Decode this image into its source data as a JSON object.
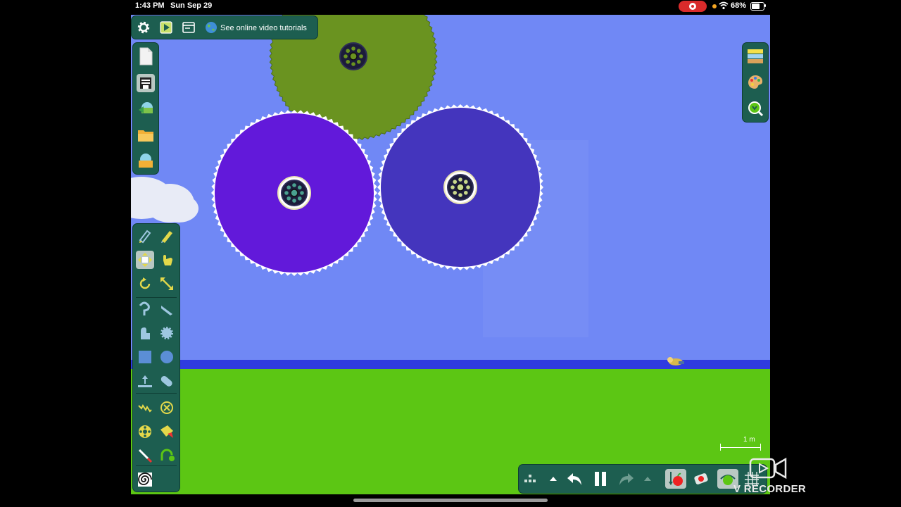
{
  "status_bar": {
    "time": "1:43 PM",
    "date": "Sun Sep 29",
    "battery": "68%",
    "battery_level": 0.68
  },
  "top_toolbar": {
    "tutorial_label": "See online video tutorials",
    "icons": [
      "gear-icon",
      "play-scene-icon",
      "window-icon",
      "globe-icon"
    ]
  },
  "file_toolbar": {
    "icons": [
      "new-document-icon",
      "save-icon",
      "open-scene-icon",
      "folder-icon",
      "browse-scenes-icon"
    ]
  },
  "right_toolbar": {
    "icons": [
      "background-icon",
      "palette-icon",
      "zoom-icon"
    ]
  },
  "tools": [
    {
      "name": "sketch-tool",
      "icon": "pencil-hand-icon"
    },
    {
      "name": "pencil-tool",
      "icon": "pencil-icon"
    },
    {
      "name": "move-tool",
      "icon": "move-arrows-icon",
      "selected": true
    },
    {
      "name": "drag-tool",
      "icon": "hand-icon"
    },
    {
      "name": "rotate-tool",
      "icon": "rotate-icon"
    },
    {
      "name": "scale-tool",
      "icon": "scale-arrows-icon"
    },
    {
      "name": "rope-tool",
      "icon": "rope-icon"
    },
    {
      "name": "knife-tool",
      "icon": "knife-icon"
    },
    {
      "name": "brush-tool",
      "icon": "brush-icon"
    },
    {
      "name": "gear-tool",
      "icon": "gear-shape-icon"
    },
    {
      "name": "box-tool",
      "icon": "square-icon"
    },
    {
      "name": "circle-tool",
      "icon": "circle-icon"
    },
    {
      "name": "plane-tool",
      "icon": "plane-icon"
    },
    {
      "name": "polygon-tool",
      "icon": "capsule-icon"
    },
    {
      "name": "spring-tool",
      "icon": "spring-icon"
    },
    {
      "name": "fixate-tool",
      "icon": "fixate-icon"
    },
    {
      "name": "axle-tool",
      "icon": "axle-icon"
    },
    {
      "name": "thruster-tool",
      "icon": "thruster-icon"
    },
    {
      "name": "laser-tool",
      "icon": "laser-icon"
    },
    {
      "name": "hinge-tool",
      "icon": "hinge-icon"
    },
    {
      "name": "tracer-tool",
      "icon": "spiral-icon"
    }
  ],
  "bottom_toolbar": {
    "icons": [
      "grid-icon",
      "chevron-up-icon",
      "undo-icon",
      "pause-icon",
      "redo-icon",
      "chevron-up-icon",
      "gravity-icon",
      "air-friction-icon",
      "camera-follow-icon",
      "grid-snap-icon"
    ]
  },
  "scene": {
    "gears": [
      {
        "name": "olive-gear",
        "color": "#6a9320"
      },
      {
        "name": "purple-gear",
        "color": "#6219da"
      },
      {
        "name": "indigo-gear",
        "color": "#4435bd"
      }
    ],
    "sky_color": "#7088f5",
    "ground_color": "#5cc614"
  },
  "scale_label": "1 m",
  "watermark": {
    "text": "V RECORDER"
  }
}
